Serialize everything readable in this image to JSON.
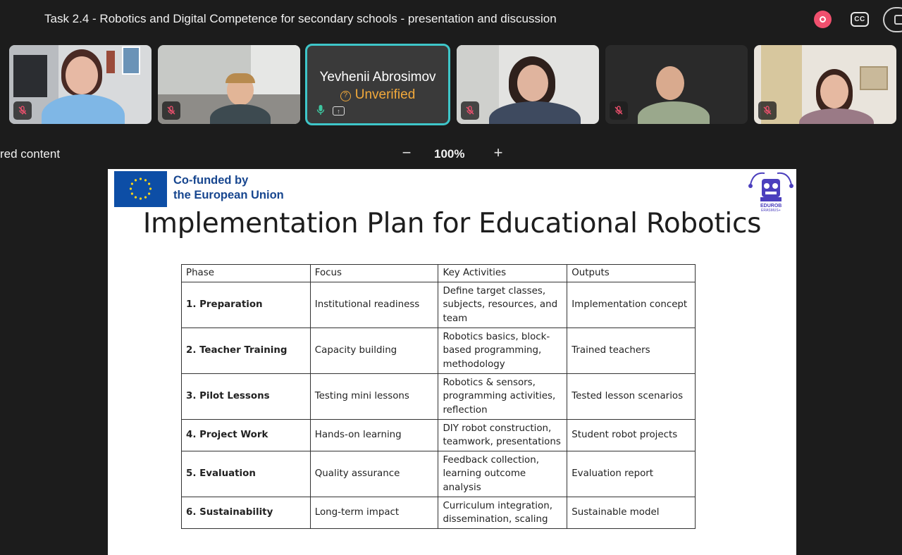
{
  "meeting": {
    "title": "Task 2.4 - Robotics and Digital Competence for secondary schools - presentation and discussion",
    "cc_label": "CC"
  },
  "participants": [
    {
      "name": "",
      "muted": true
    },
    {
      "name": "",
      "muted": true
    },
    {
      "name": "Yevhenii Abrosimov",
      "status": "Unverified",
      "muted": false,
      "active": true
    },
    {
      "name": "",
      "muted": true
    },
    {
      "name": "",
      "muted": true
    },
    {
      "name": "",
      "muted": true
    }
  ],
  "shared": {
    "label": "red content",
    "zoom": "100%",
    "zoom_minus": "−",
    "zoom_plus": "+"
  },
  "slide": {
    "funding_line1": "Co-funded by",
    "funding_line2": "the European Union",
    "logo_text": "EDUROB",
    "logo_sub": "ERASMUS+",
    "title": "Implementation Plan for Educational Robotics",
    "table": {
      "headers": [
        "Phase",
        "Focus",
        "Key Activities",
        "Outputs"
      ],
      "rows": [
        {
          "phase": "1. Preparation",
          "focus": "Institutional readiness",
          "activities": "Define target classes, subjects, resources, and team",
          "outputs": "Implementation concept"
        },
        {
          "phase": "2. Teacher Training",
          "focus": "Capacity building",
          "activities": "Robotics basics, block-based programming, methodology",
          "outputs": "Trained teachers"
        },
        {
          "phase": "3. Pilot Lessons",
          "focus": "Testing mini lessons",
          "activities": "Robotics & sensors, programming activities, reflection",
          "outputs": "Tested lesson scenarios"
        },
        {
          "phase": "4. Project Work",
          "focus": "Hands-on learning",
          "activities": "DIY robot construction, teamwork, presentations",
          "outputs": "Student robot projects"
        },
        {
          "phase": "5. Evaluation",
          "focus": "Quality assurance",
          "activities": "Feedback collection, learning outcome analysis",
          "outputs": "Evaluation report"
        },
        {
          "phase": "6. Sustainability",
          "focus": "Long-term impact",
          "activities": "Curriculum integration, dissemination, scaling",
          "outputs": "Sustainable model"
        }
      ]
    }
  },
  "colors": {
    "background": "#1c1c1c",
    "active_border": "#3ec6c9",
    "unverified": "#f2a93b",
    "record": "#f0506e",
    "eu_blue": "#0d4ea6",
    "eu_text": "#17468f"
  },
  "icons": [
    "record-icon",
    "closed-captions-icon",
    "more-options-icon",
    "mic-off-icon",
    "mic-on-icon",
    "screen-share-icon",
    "question-icon",
    "zoom-out-icon",
    "zoom-in-icon",
    "eu-flag-icon",
    "edurob-logo-icon"
  ]
}
